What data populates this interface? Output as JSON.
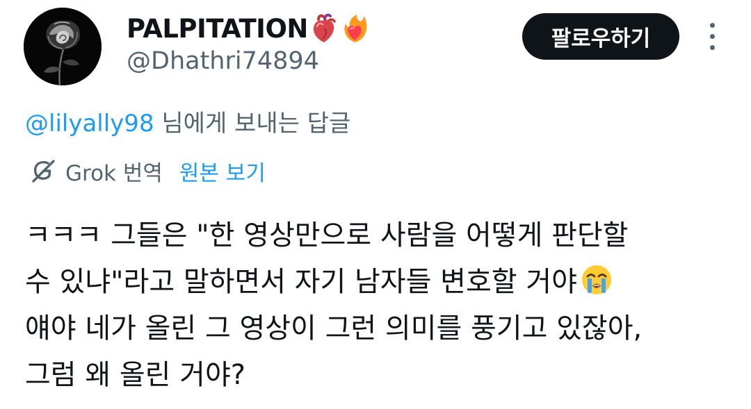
{
  "author": {
    "display_name": "PALPITATION",
    "name_emojis": [
      "anatomical-heart-emoji",
      "heart-on-fire-emoji"
    ],
    "handle": "@Dhathri74894",
    "avatar": "black-rose-avatar"
  },
  "follow_button_label": "팔로우하기",
  "reply_context": {
    "mention": "@lilyally98",
    "suffix": " 님에게 보내는 답글"
  },
  "translation": {
    "label": "Grok 번역",
    "link": "원본 보기"
  },
  "tweet": {
    "lines": [
      "ㅋㅋㅋ 그들은 \"한 영상만으로 사람을 어떻게 판단할",
      "수 있냐\"라고 말하면서 자기 남자들 변호할 거야",
      "얘야 네가 올린 그 영상이 그런 의미를 풍기고 있잖아,",
      "그럼 왜 올린 거야?"
    ],
    "line2_emoji": "loudly-crying-face-emoji"
  },
  "colors": {
    "text_primary": "#0f1419",
    "text_secondary": "#536471",
    "link_blue": "#1d9bf0",
    "follow_bg": "#0f1419"
  }
}
